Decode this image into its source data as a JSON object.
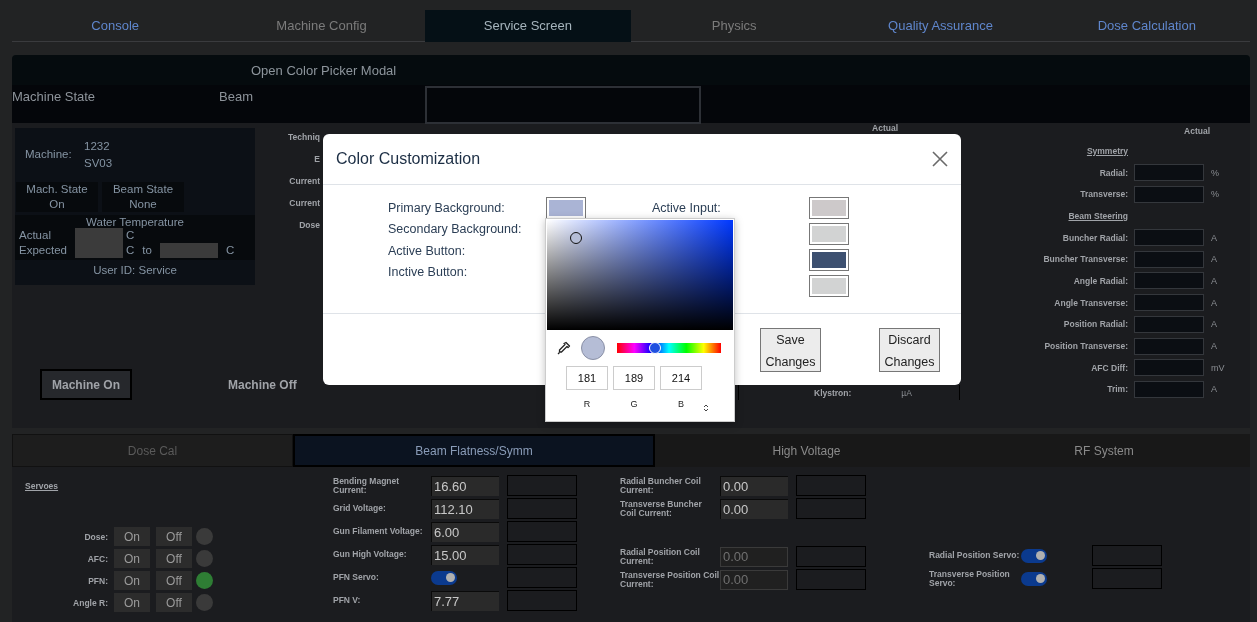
{
  "tabs": [
    {
      "label": "Console",
      "selected": false,
      "disabled": false
    },
    {
      "label": "Machine Config",
      "selected": false,
      "disabled": true
    },
    {
      "label": "Service Screen",
      "selected": true,
      "disabled": false
    },
    {
      "label": "Physics",
      "selected": false,
      "disabled": true
    },
    {
      "label": "Quality Assurance",
      "selected": false,
      "disabled": false
    },
    {
      "label": "Dose Calculation",
      "selected": false,
      "disabled": false
    }
  ],
  "top_bar": {
    "button": "Open Color Picker Modal"
  },
  "state_bar": {
    "machine_state": "Machine State",
    "beam": "Beam"
  },
  "machine_panel": {
    "machine_label": "Machine:",
    "machine_id": "1232",
    "machine_name": "SV03",
    "mach_state_label": "Mach. State",
    "mach_state": "On",
    "beam_state_label": "Beam State",
    "beam_state": "None",
    "water_title": "Water Temperature",
    "actual_label": "Actual",
    "actual_unit": "C",
    "expected_label": "Expected",
    "expected_unit": "C",
    "to": "to",
    "to_unit": "C",
    "user_id": "User ID: Service"
  },
  "partial_labels": [
    "Techniq",
    "E",
    "Current",
    "Current",
    "Dose"
  ],
  "actual_headers": [
    "Actual",
    "Actual"
  ],
  "steering": [
    {
      "kind": "heading",
      "label": "Symmetry"
    },
    {
      "kind": "field",
      "label": "Radial:",
      "unit": "%"
    },
    {
      "kind": "field",
      "label": "Transverse:",
      "unit": "%"
    },
    {
      "kind": "heading",
      "label": "Beam Steering"
    },
    {
      "kind": "field",
      "label": "Buncher Radial:",
      "unit": "A"
    },
    {
      "kind": "field",
      "label": "Buncher Transverse:",
      "unit": "A"
    },
    {
      "kind": "field",
      "label": "Angle Radial:",
      "unit": "A"
    },
    {
      "kind": "field",
      "label": "Angle Transverse:",
      "unit": "A"
    },
    {
      "kind": "field",
      "label": "Position Radial:",
      "unit": "A"
    },
    {
      "kind": "field",
      "label": "Position Transverse:",
      "unit": "A"
    },
    {
      "kind": "field",
      "label": "AFC Diff:",
      "unit": "mV"
    },
    {
      "kind": "field",
      "label": "Trim:",
      "unit": "A"
    }
  ],
  "machine_buttons": [
    {
      "label": "Machine On",
      "selected": true
    },
    {
      "label": "Machine Off",
      "selected": false
    }
  ],
  "klystron": {
    "label": "Klystron:",
    "unit": "µA"
  },
  "sub_tabs": [
    {
      "label": "Dose Cal",
      "selected": false,
      "disabled": true
    },
    {
      "label": "Beam Flatness/Symm",
      "selected": true,
      "disabled": false
    },
    {
      "label": "High Voltage",
      "selected": false,
      "disabled": false
    },
    {
      "label": "RF System",
      "selected": false,
      "disabled": false
    }
  ],
  "servoes": {
    "title": "Servoes",
    "rows": [
      {
        "label": "Dose:",
        "on": "On",
        "off": "Off",
        "active": false
      },
      {
        "label": "AFC:",
        "on": "On",
        "off": "Off",
        "active": false
      },
      {
        "label": "PFN:",
        "on": "On",
        "off": "Off",
        "active": true
      },
      {
        "label": "Angle R:",
        "on": "On",
        "off": "Off",
        "active": false
      }
    ]
  },
  "readings": [
    {
      "kind": "input",
      "label": "Bending Magnet Current:",
      "value": "16.60"
    },
    {
      "kind": "input",
      "label": "Grid Voltage:",
      "value": "112.10"
    },
    {
      "kind": "input",
      "label": "Gun Filament Voltage:",
      "value": "6.00"
    },
    {
      "kind": "input",
      "label": "Gun High Voltage:",
      "value": "15.00"
    },
    {
      "kind": "toggle",
      "label": "PFN Servo:",
      "on": true
    },
    {
      "kind": "input",
      "label": "PFN V:",
      "value": "7.77"
    }
  ],
  "coils": [
    {
      "label": "Radial Buncher Coil Current:",
      "value": "0.00",
      "disabled": false
    },
    {
      "label": "Transverse Buncher Coil Current:",
      "value": "0.00",
      "disabled": false
    },
    {
      "label": "Radial Position Coil Current:",
      "value": "0.00",
      "disabled": true
    },
    {
      "label": "Transverse Position Coil Current:",
      "value": "0.00",
      "disabled": true
    }
  ],
  "servos": [
    {
      "label": "Radial Position Servo:",
      "on": true
    },
    {
      "label": "Transverse Position Servo:",
      "on": true
    }
  ],
  "modal": {
    "title": "Color Customization",
    "left": [
      {
        "label": "Primary Background:",
        "color": "#aab4d5"
      },
      {
        "label": "Secondary Background:"
      },
      {
        "label": "Active Button:"
      },
      {
        "label": "Inctive Button:"
      }
    ],
    "right": [
      {
        "label": "Active Input:",
        "color": "#cdc9ca"
      },
      {
        "color": "#d2d3d3"
      },
      {
        "color": "#3d5070"
      },
      {
        "color": "#d2d3d3"
      }
    ],
    "buttons": [
      "Save Changes",
      "Discard Changes"
    ],
    "picker": {
      "hue": {
        "level": 0.37
      },
      "channels": [
        {
          "label": "R",
          "value": "181"
        },
        {
          "label": "G",
          "value": "189"
        },
        {
          "label": "B",
          "value": "214"
        }
      ]
    }
  }
}
